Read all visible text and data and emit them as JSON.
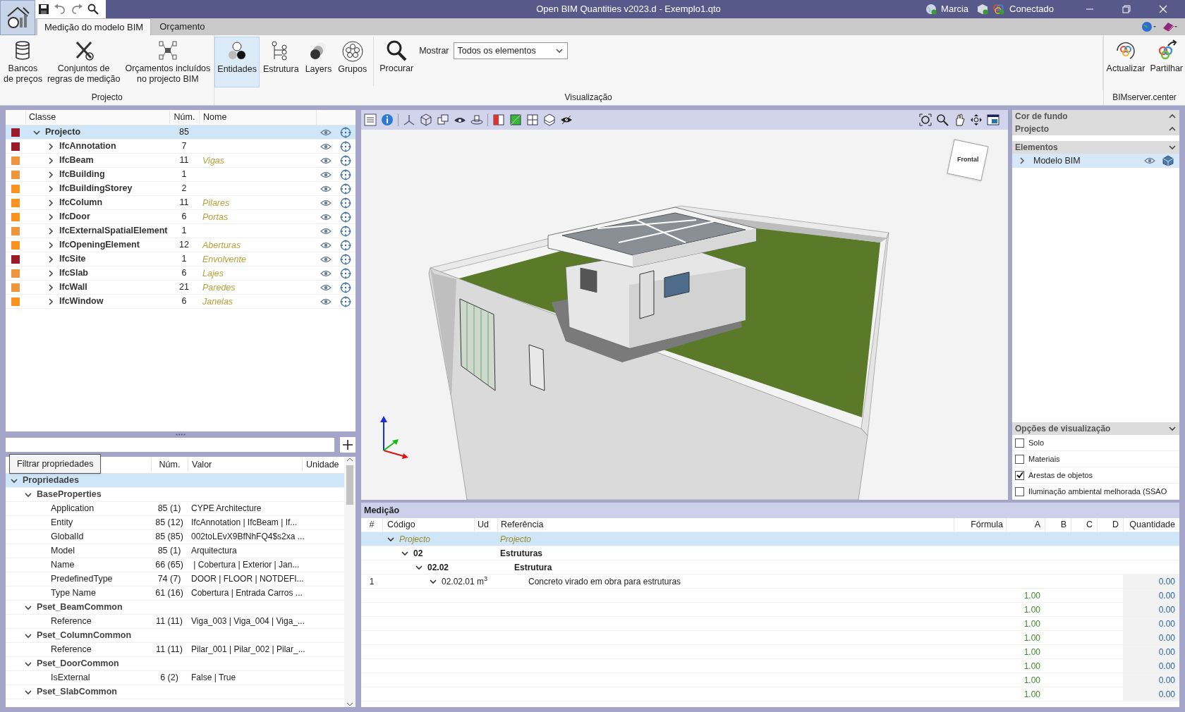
{
  "window": {
    "title": "Open BIM Quantities v2023.d - Exemplo1.qto",
    "user": "Marcia",
    "connection": "Conectado"
  },
  "tabs": [
    {
      "label": "Medição do modelo BIM",
      "selected": true
    },
    {
      "label": "Orçamento",
      "selected": false
    }
  ],
  "ribbon": {
    "groups": [
      {
        "label": "Projecto",
        "buttons": [
          {
            "label": "Bancos\nde preços"
          },
          {
            "label": "Conjuntos de\nregras de medição"
          },
          {
            "label": "Orçamentos incluídos\nno projecto BIM"
          }
        ]
      },
      {
        "label": "Visualização",
        "modes": [
          {
            "label": "Entidades",
            "selected": true
          },
          {
            "label": "Estrutura",
            "selected": false
          },
          {
            "label": "Layers",
            "selected": false
          },
          {
            "label": "Grupos",
            "selected": false
          }
        ],
        "buttons": [
          {
            "label": "Procurar"
          }
        ],
        "filter": {
          "label": "Mostrar",
          "value": "Todos os elementos"
        }
      },
      {
        "label": "BIMserver.center",
        "buttons": [
          {
            "label": "Actualizar"
          },
          {
            "label": "Partilhar"
          }
        ]
      }
    ]
  },
  "classes": {
    "columns": [
      "Classe",
      "Núm.",
      "Nome"
    ],
    "rows": [
      {
        "label": "Projecto",
        "count": "85",
        "color": "#9b1b2b",
        "expanded": true,
        "selected": true,
        "children": [
          {
            "label": "IfcAnnotation",
            "count": "7",
            "color": "#9b1b2b",
            "expanded": false,
            "selected": false
          },
          {
            "label": "IfcBeam",
            "count": "11",
            "name": "Vigas",
            "color": "#ee9540",
            "expanded": false,
            "selected": false
          },
          {
            "label": "IfcBuilding",
            "count": "1",
            "color": "#ee9540",
            "expanded": false,
            "selected": false
          },
          {
            "label": "IfcBuildingStorey",
            "count": "2",
            "color": "#f7931e",
            "expanded": false,
            "selected": false
          },
          {
            "label": "IfcColumn",
            "count": "11",
            "name": "Pilares",
            "color": "#f7931e",
            "expanded": false,
            "selected": false
          },
          {
            "label": "IfcDoor",
            "count": "6",
            "name": "Portas",
            "color": "#f7931e",
            "expanded": false,
            "selected": false
          },
          {
            "label": "IfcExternalSpatialElement",
            "count": "1",
            "color": "#ee9540",
            "expanded": false,
            "selected": false
          },
          {
            "label": "IfcOpeningElement",
            "count": "12",
            "name": "Aberturas",
            "color": "#f7931e",
            "expanded": false,
            "selected": false
          },
          {
            "label": "IfcSite",
            "count": "1",
            "name": "Envolvente",
            "color": "#9b1b2b",
            "expanded": false,
            "selected": false
          },
          {
            "label": "IfcSlab",
            "count": "6",
            "name": "Lajes",
            "color": "#ee9540",
            "expanded": false,
            "selected": false
          },
          {
            "label": "IfcWall",
            "count": "21",
            "name": "Paredes",
            "color": "#ee9540",
            "expanded": false,
            "selected": false
          },
          {
            "label": "IfcWindow",
            "count": "6",
            "name": "Janelas",
            "color": "#f7931e",
            "expanded": false,
            "selected": false
          }
        ]
      }
    ]
  },
  "properties": {
    "tooltip": "Filtrar propriedades",
    "columns": [
      "Núm.",
      "Valor",
      "Unidade"
    ],
    "rows": [
      {
        "kind": "group",
        "label": "Propriedades",
        "expanded": true,
        "selected": true,
        "children": [
          {
            "kind": "group",
            "label": "BaseProperties",
            "expanded": true,
            "selected": false,
            "children": [
              {
                "kind": "property",
                "label": "Application",
                "count": "85 (1)",
                "value": "CYPE Architecture"
              },
              {
                "kind": "property",
                "label": "Entity",
                "count": "85 (12)",
                "value": "IfcAnnotation | IfcBeam | If..."
              },
              {
                "kind": "property",
                "label": "GlobalId",
                "count": "85 (85)",
                "value": "002toLEvX9BfNhFQ4$s2xa ..."
              },
              {
                "kind": "property",
                "label": "Model",
                "count": "85 (1)",
                "value": "Arquitectura"
              },
              {
                "kind": "property",
                "label": "Name",
                "count": "66 (65)",
                "value": " | Cobertura | Exterior | Jan..."
              },
              {
                "kind": "property",
                "label": "PredefinedType",
                "count": "74 (7)",
                "value": "DOOR | FLOOR | NOTDEFI..."
              },
              {
                "kind": "property",
                "label": "Type Name",
                "count": "61 (16)",
                "value": "Cobertura | Entrada Carros ..."
              }
            ]
          },
          {
            "kind": "group",
            "label": "Pset_BeamCommon",
            "expanded": true,
            "selected": false,
            "children": [
              {
                "kind": "property",
                "label": "Reference",
                "count": "11 (11)",
                "value": "Viga_003 | Viga_004 | Viga_..."
              }
            ]
          },
          {
            "kind": "group",
            "label": "Pset_ColumnCommon",
            "expanded": true,
            "selected": false,
            "children": [
              {
                "kind": "property",
                "label": "Reference",
                "count": "11 (11)",
                "value": "Pilar_001 | Pilar_002 | Pilar_..."
              }
            ]
          },
          {
            "kind": "group",
            "label": "Pset_DoorCommon",
            "expanded": true,
            "selected": false,
            "children": [
              {
                "kind": "property",
                "label": "IsExternal",
                "count": "6 (2)",
                "value": "False | True"
              }
            ]
          },
          {
            "kind": "group",
            "label": "Pset_SlabCommon",
            "expanded": true,
            "selected": false
          }
        ]
      }
    ]
  },
  "viewport": {
    "view_cube": "Frontal"
  },
  "side_panel": {
    "sections": [
      {
        "title": "Cor de fundo",
        "expanded": false
      },
      {
        "title": "Projecto",
        "expanded": false
      },
      {
        "title": "Elementos",
        "expanded": true,
        "items": [
          {
            "label": "Modelo BIM",
            "selected": true,
            "expanded": false
          }
        ]
      },
      {
        "title": "Opções de visualização",
        "expanded": true,
        "options": [
          {
            "label": "Solo",
            "checked": false
          },
          {
            "label": "Materiais",
            "checked": false
          },
          {
            "label": "Arestas de objetos",
            "checked": true
          },
          {
            "label": "Iluminação ambiental melhorada (SSAO",
            "checked": false
          }
        ]
      }
    ]
  },
  "measurement": {
    "title": "Medição",
    "columns": [
      "#",
      "Código",
      "Ud",
      "Referência",
      "Fórmula",
      "A",
      "B",
      "C",
      "D",
      "Quantidade"
    ],
    "rows": [
      {
        "kind": "root",
        "code": "Projecto",
        "reference": "Projecto",
        "expanded": true,
        "selected": true,
        "children": [
          {
            "kind": "chapter",
            "code": "02",
            "reference": "Estruturas",
            "expanded": true,
            "selected": false,
            "children": [
              {
                "kind": "chapter",
                "code": "02.02",
                "reference": "Estrutura",
                "expanded": true,
                "selected": false,
                "children": [
                  {
                    "kind": "item",
                    "number": "1",
                    "code": "02.02.01",
                    "unit": "m$^{3}$",
                    "reference": "Concreto virado em obra para estruturas",
                    "quantity": "0.00",
                    "expanded": true,
                    "selected": false,
                    "children": [
                      {
                        "kind": "line",
                        "a": "1.00",
                        "quantity": "0.00",
                        "selected": false
                      },
                      {
                        "kind": "line",
                        "a": "1.00",
                        "quantity": "0.00",
                        "selected": false
                      },
                      {
                        "kind": "line",
                        "a": "1.00",
                        "quantity": "0.00",
                        "selected": false
                      },
                      {
                        "kind": "line",
                        "a": "1.00",
                        "quantity": "0.00",
                        "selected": false
                      },
                      {
                        "kind": "line",
                        "a": "1.00",
                        "quantity": "0.00",
                        "selected": false
                      },
                      {
                        "kind": "line",
                        "a": "1.00",
                        "quantity": "0.00",
                        "selected": false
                      },
                      {
                        "kind": "line",
                        "a": "1.00",
                        "quantity": "0.00",
                        "selected": false
                      },
                      {
                        "kind": "line",
                        "a": "1.00",
                        "quantity": "0.00",
                        "selected": false
                      }
                    ]
                  }
                ]
              }
            ]
          }
        ]
      }
    ]
  }
}
